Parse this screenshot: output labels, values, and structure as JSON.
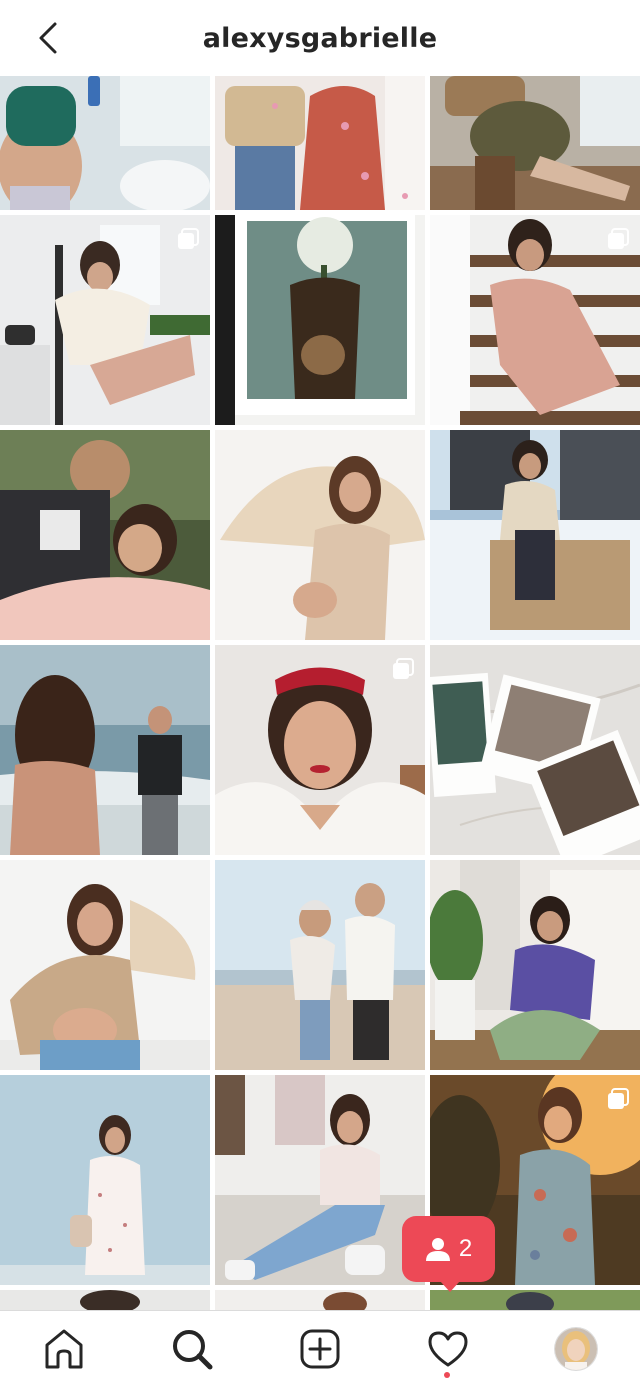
{
  "header": {
    "title": "alexysgabrielle",
    "back_icon": "chevron-left-icon"
  },
  "grid": {
    "columns": 3,
    "tiles": [
      {
        "scene": "bathroom-green-bra",
        "multi": false
      },
      {
        "scene": "pink-dress-confetti",
        "multi": false
      },
      {
        "scene": "olive-dress-window",
        "multi": false
      },
      {
        "scene": "cream-sweater-chair",
        "multi": true
      },
      {
        "scene": "polaroid-flowers",
        "multi": false
      },
      {
        "scene": "pink-dress-stairs",
        "multi": true
      },
      {
        "scene": "couple-selfie",
        "multi": false
      },
      {
        "scene": "beige-top-fan",
        "multi": false
      },
      {
        "scene": "snow-sitting-wall",
        "multi": false
      },
      {
        "scene": "beach-couple",
        "multi": false
      },
      {
        "scene": "red-headband-portrait",
        "multi": true
      },
      {
        "scene": "polaroids-marble",
        "multi": false
      },
      {
        "scene": "beige-shirt-fan-bump",
        "multi": false
      },
      {
        "scene": "beach-beanie-couple",
        "multi": false
      },
      {
        "scene": "purple-cardigan-selfie",
        "multi": false
      },
      {
        "scene": "floral-dress-blue-wall",
        "multi": false
      },
      {
        "scene": "jeans-sitting-doorway",
        "multi": false
      },
      {
        "scene": "sunset-floral-dress",
        "multi": true
      }
    ]
  },
  "notification": {
    "icon": "person-icon",
    "count": "2"
  },
  "bottom_nav": {
    "items": [
      "home-icon",
      "search-icon",
      "add-post-icon",
      "heart-icon",
      "profile-avatar"
    ],
    "active": "search-icon",
    "activity_dot_color": "#ed4956"
  },
  "colors": {
    "accent": "#ed4956",
    "text": "#262626",
    "divider": "#dbdbdb"
  }
}
